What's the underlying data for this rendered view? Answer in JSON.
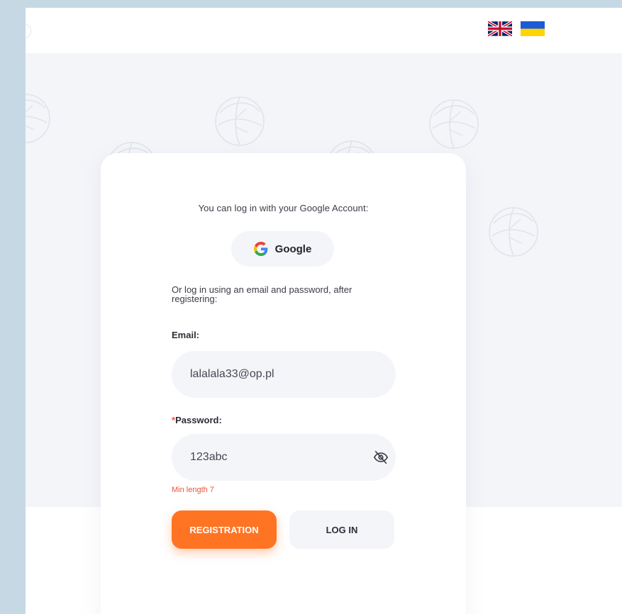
{
  "header": {
    "languages": [
      {
        "code": "en",
        "icon": "uk-flag-icon"
      },
      {
        "code": "uk",
        "icon": "ukraine-flag-icon"
      }
    ]
  },
  "login": {
    "google_prompt": "You can log in with your Google Account:",
    "google_button_label": "Google",
    "email_prompt": "Or log in using an email and password, after registering:",
    "email_label": "Email:",
    "email_value": "lalalala33@op.pl",
    "password_required_mark": "*",
    "password_label": "Password:",
    "password_value": "123abc",
    "password_error": "Min length 7",
    "register_button": "REGISTRATION",
    "login_button": "LOG IN"
  },
  "colors": {
    "accent": "#ff7423",
    "error": "#e8543f",
    "field_background": "#f4f5f9",
    "page_background": "#c7d8e5"
  },
  "icons": [
    "google-icon",
    "eye-slash-icon",
    "cabbage-icon"
  ]
}
